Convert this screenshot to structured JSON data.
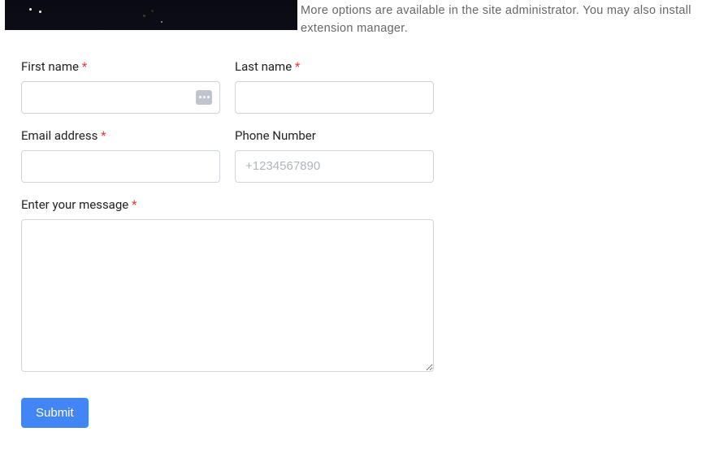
{
  "intro_text": "More options are available in the site administrator. You may also install extension manager.",
  "form": {
    "first_name": {
      "label": "First name",
      "required": "*",
      "value": ""
    },
    "last_name": {
      "label": "Last name",
      "required": "*",
      "value": ""
    },
    "email": {
      "label": "Email address",
      "required": "*",
      "value": ""
    },
    "phone": {
      "label": "Phone Number",
      "placeholder": "+1234567890",
      "value": ""
    },
    "message": {
      "label": "Enter your message",
      "required": "*",
      "value": ""
    },
    "submit_label": "Submit"
  }
}
